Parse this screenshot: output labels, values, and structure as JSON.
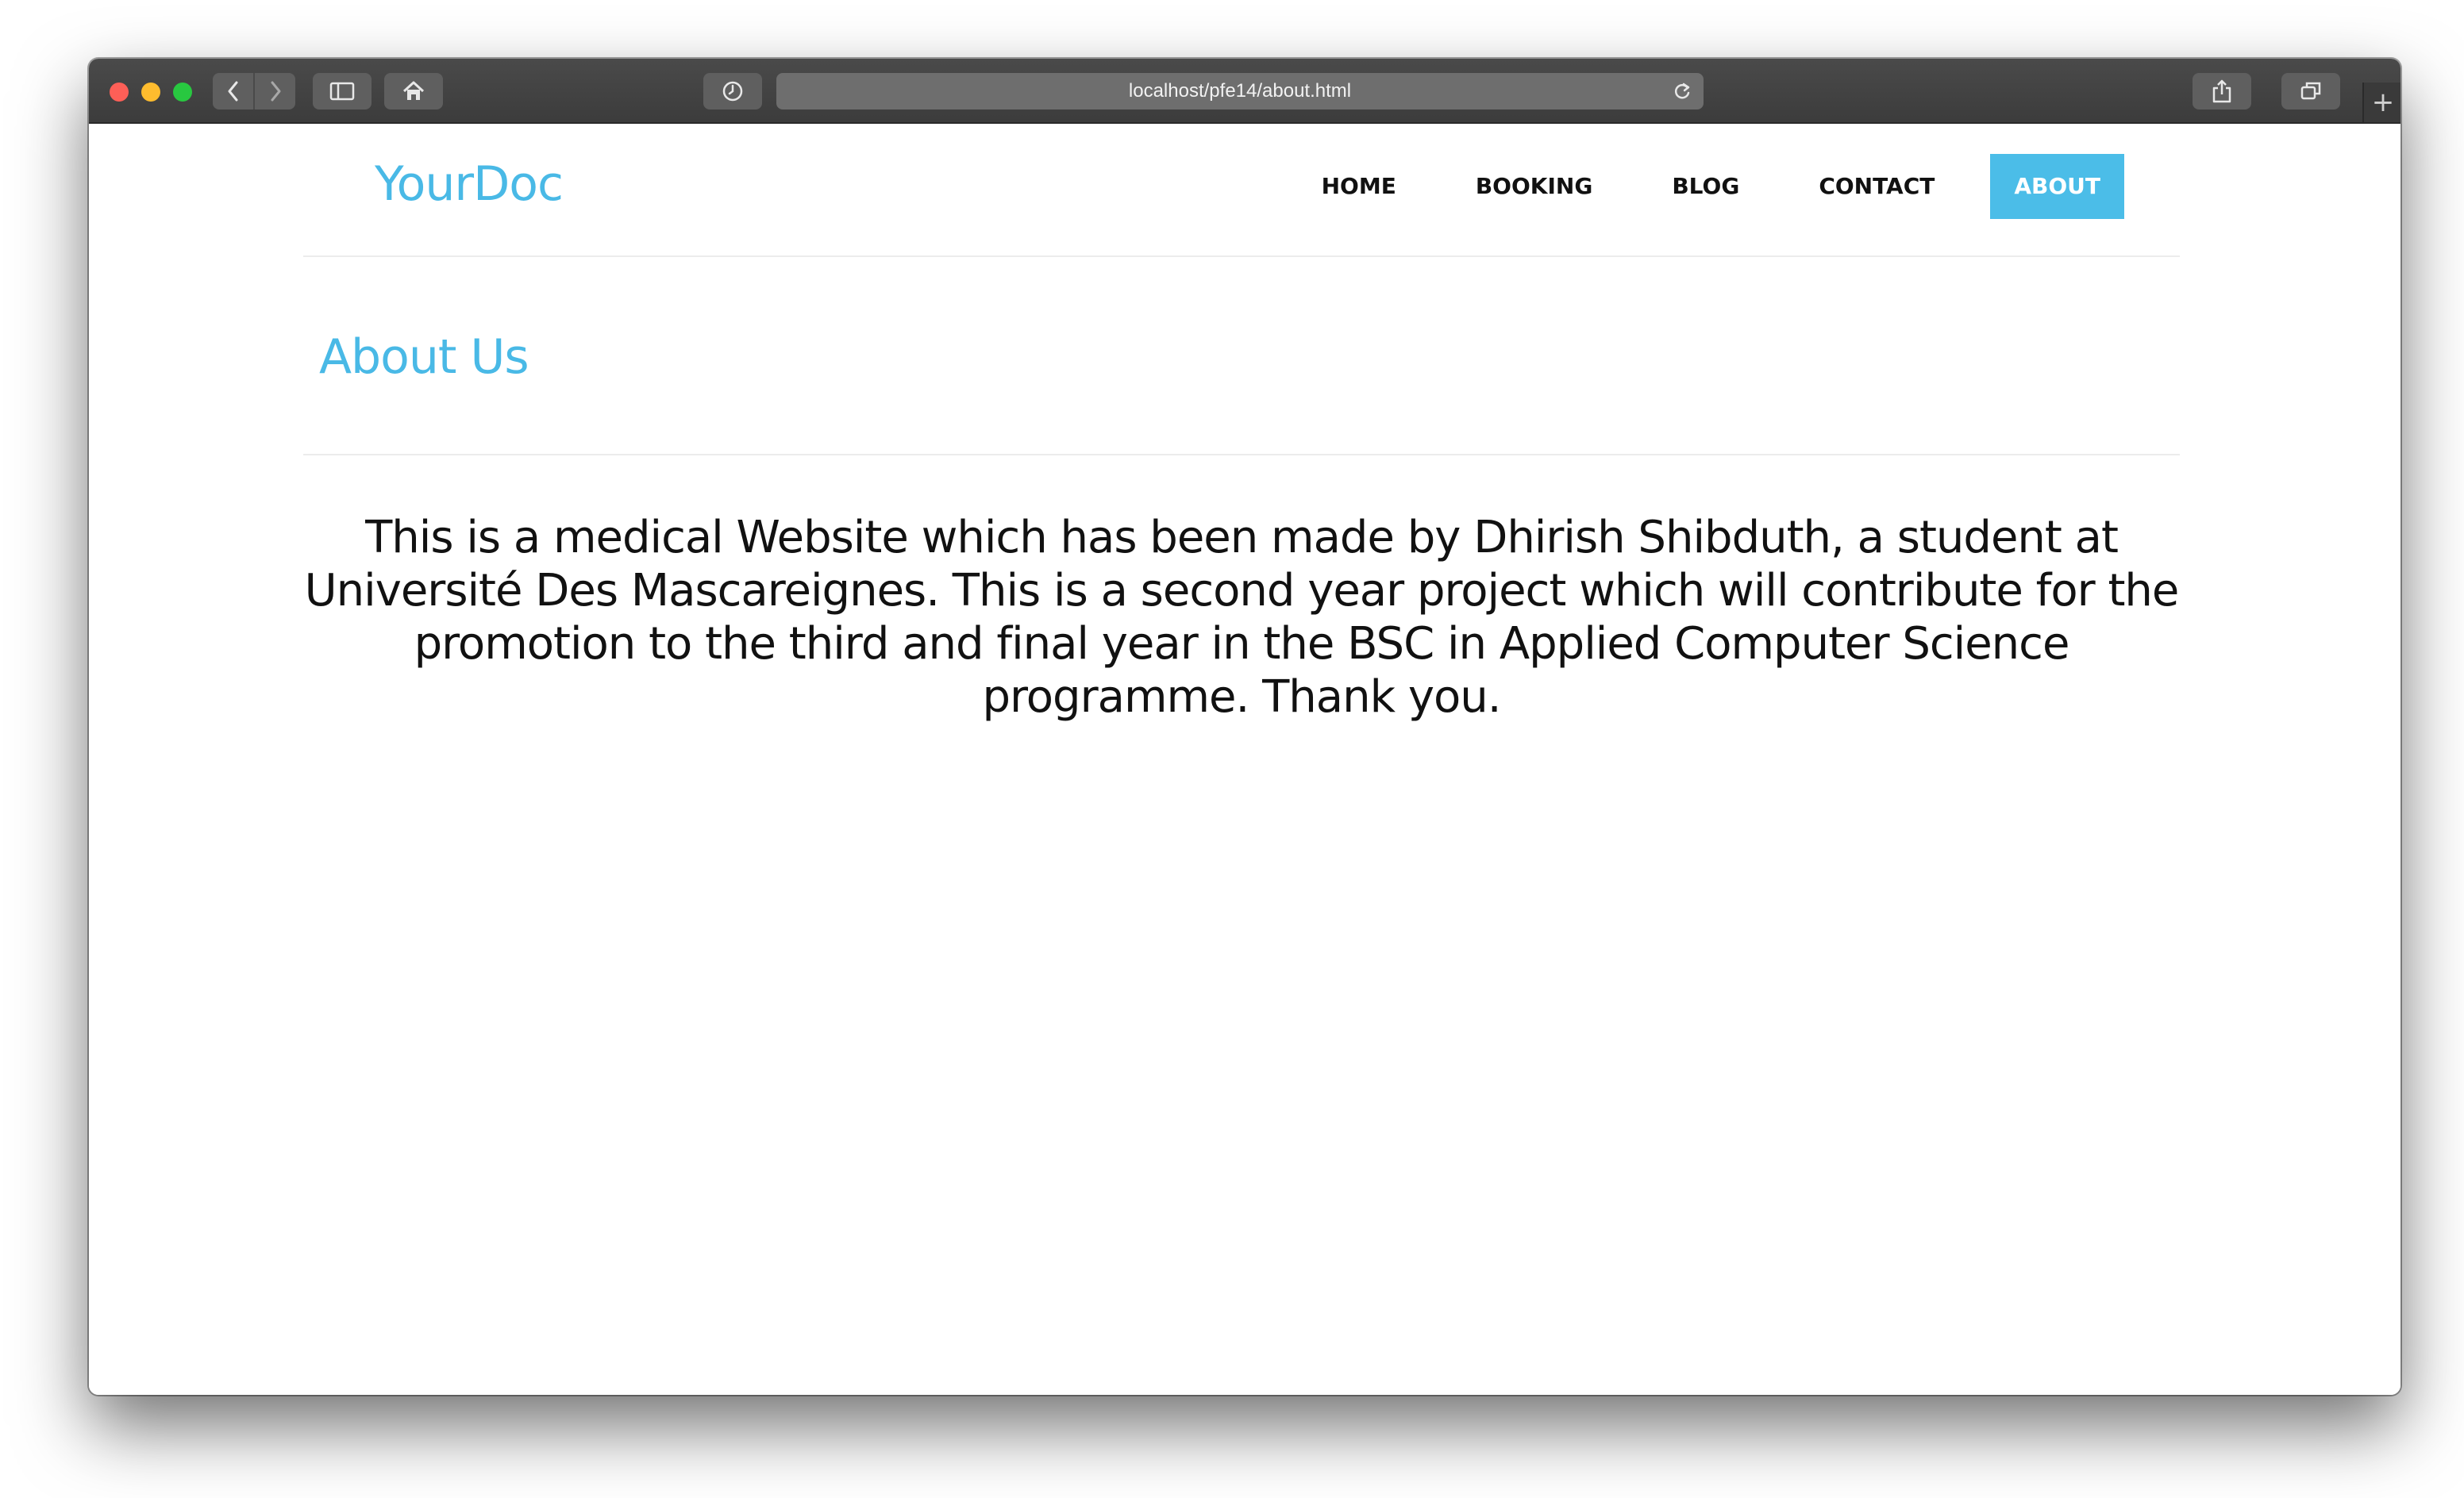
{
  "browser": {
    "url": "localhost/pfe14/about.html",
    "new_tab_symbol": "+",
    "icons": {
      "back": "chevron-left-icon",
      "forward": "chevron-right-icon",
      "sidebar": "sidebar-icon",
      "home": "home-icon",
      "history": "clock-icon",
      "reload": "reload-icon",
      "share": "share-icon",
      "tabs": "tabs-overview-icon"
    }
  },
  "site": {
    "logo": "YourDoc",
    "nav": [
      {
        "label": "HOME"
      },
      {
        "label": "BOOKING"
      },
      {
        "label": "BLOG"
      },
      {
        "label": "CONTACT"
      },
      {
        "label": "ABOUT",
        "active": true
      }
    ],
    "accent_color": "#4bbde8"
  },
  "page": {
    "title": "About Us",
    "body": "This is a medical Website which has been made by Dhirish Shibduth, a student at Université Des Mascareignes. This is a second year project which will contribute for the promotion to the third and final year in the BSC in Applied Computer Science programme. Thank you."
  }
}
